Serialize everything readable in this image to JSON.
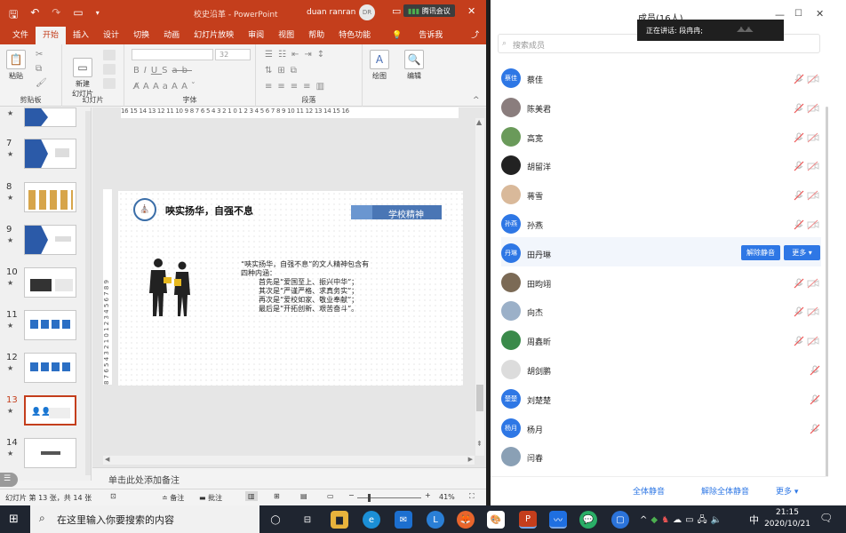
{
  "ppt": {
    "filename": "校史沿革",
    "app": "PowerPoint",
    "user_name": "duan ranran",
    "user_initials": "DR",
    "meeting_app": "腾讯会议",
    "tabs": [
      "文件",
      "开始",
      "插入",
      "设计",
      "切换",
      "动画",
      "幻灯片放映",
      "审阅",
      "视图",
      "帮助",
      "特色功能",
      "告诉我",
      "共享"
    ],
    "ribbon": {
      "paste": "粘贴",
      "new_slide": "新建\n幻灯片",
      "font_size": "32",
      "draw": "绘图",
      "edit": "编辑",
      "groups": [
        "剪贴板",
        "幻灯片",
        "字体",
        "段落"
      ]
    },
    "slide_numbers": [
      "7",
      "8",
      "9",
      "10",
      "11",
      "12",
      "13",
      "14"
    ],
    "h_ruler": "16 15 14 13 12 11 10 9 8 7 6 5 4 3 2 1 0 1 2 3 4 5 6 7 8 9 10 11 12 13 14 15 16",
    "v_ruler": "8 7 6 5 4 3 2 1 0 1 2 3 4 5 6 7 8 9",
    "slide": {
      "heading": "唊实扬华，自强不息",
      "tag": "学校精神",
      "body_lines": [
        "“唊实扬华，自强不息”的文人精神包含有",
        "四种内涵：",
        "首先是“爱国至上、振兴中华”；",
        "其次是“严谨严格、求真务实”；",
        "再次是“爱校如家、敬业奉献”；",
        "最后是“开拓创新、艰苦奋斗”。"
      ]
    },
    "notes_placeholder": "单击此处添加备注",
    "status": {
      "slide_info": "幻灯片 第 13 张，共 14 张",
      "notes_btn": "备注",
      "comments_btn": "批注",
      "zoom": "41%"
    }
  },
  "meeting": {
    "title": "成员(16人)",
    "speaking": "正在讲话: 段冉冉;",
    "search_placeholder": "搜索成员",
    "members": [
      {
        "name": "蔡佳",
        "avatar_text": "蔡佳",
        "color": "#2e77e5",
        "mic": "muted",
        "cam": "off"
      },
      {
        "name": "陈美君",
        "avatar_text": "",
        "color": "#8a7d7d",
        "mic": "muted",
        "cam": "off"
      },
      {
        "name": "高宽",
        "avatar_text": "",
        "color": "#6a9a5a",
        "mic": "muted",
        "cam": "off"
      },
      {
        "name": "胡留洋",
        "avatar_text": "",
        "color": "#222222",
        "mic": "muted",
        "cam": "off"
      },
      {
        "name": "蒋雪",
        "avatar_text": "",
        "color": "#d9b99a",
        "mic": "muted",
        "cam": "off"
      },
      {
        "name": "孙燕",
        "avatar_text": "孙燕",
        "color": "#2e77e5",
        "mic": "muted",
        "cam": "off"
      },
      {
        "name": "田丹琳",
        "avatar_text": "丹琳",
        "color": "#2e77e5",
        "mic": "active",
        "cam": "none"
      },
      {
        "name": "田昀翊",
        "avatar_text": "",
        "color": "#7b6a55",
        "mic": "muted",
        "cam": "off"
      },
      {
        "name": "向杰",
        "avatar_text": "",
        "color": "#9bb0c8",
        "mic": "muted",
        "cam": "off"
      },
      {
        "name": "周鑫昕",
        "avatar_text": "",
        "color": "#3a8a4a",
        "mic": "muted",
        "cam": "off"
      },
      {
        "name": "胡剑鹏",
        "avatar_text": "",
        "color": "#dcdcdc",
        "mic": "muted",
        "cam": "none"
      },
      {
        "name": "刘楚楚",
        "avatar_text": "楚楚",
        "color": "#2e77e5",
        "mic": "muted",
        "cam": "none"
      },
      {
        "name": "杨月",
        "avatar_text": "杨月",
        "color": "#2e77e5",
        "mic": "muted",
        "cam": "none"
      },
      {
        "name": "闫春",
        "avatar_text": "",
        "color": "#8aa0b5",
        "mic": "none",
        "cam": "none"
      }
    ],
    "unmute_btn": "解除静音",
    "more_btn": "更多 ▾",
    "footer": {
      "mute_all": "全体静音",
      "unmute_all": "解除全体静音",
      "more": "更多 ▾"
    }
  },
  "taskbar": {
    "search_placeholder": "在这里输入你要搜索的内容",
    "ime": "中",
    "time": "21:15",
    "date": "2020/10/21"
  }
}
